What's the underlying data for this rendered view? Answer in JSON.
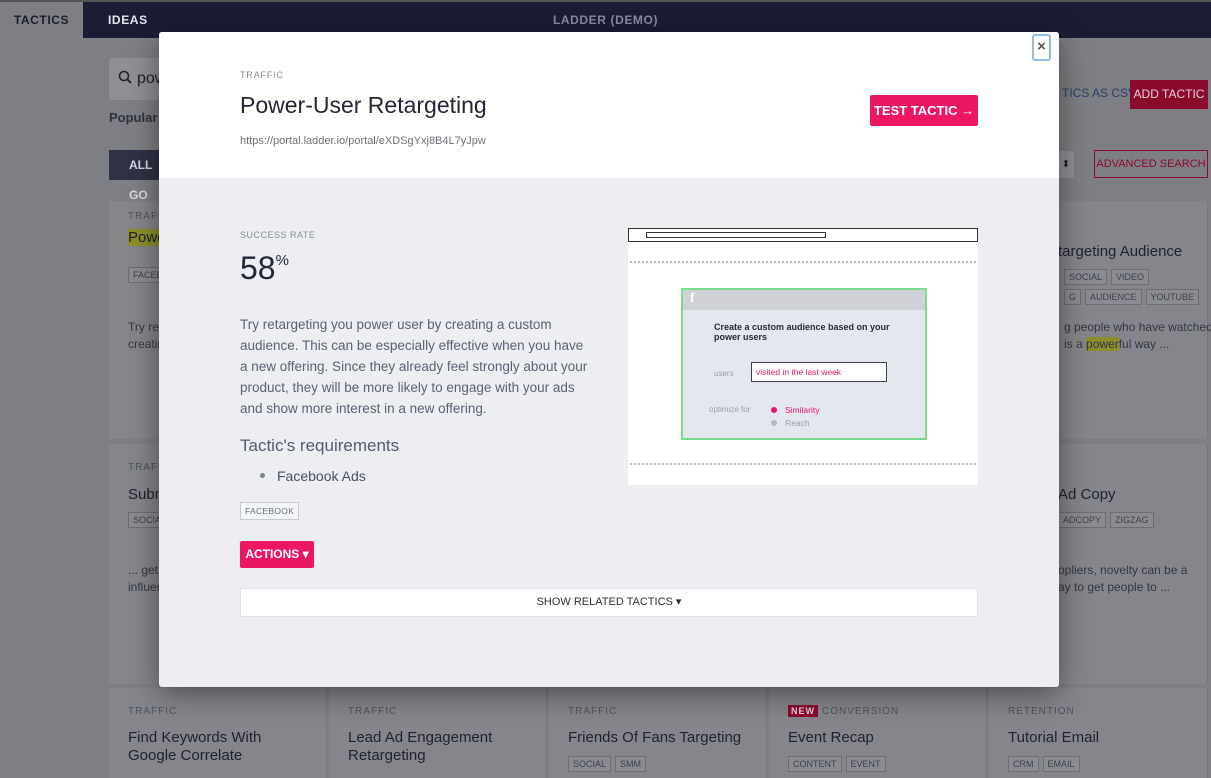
{
  "topnav": {
    "tabs": [
      "TACTICS",
      "IDEAS"
    ],
    "title": "LADDER (DEMO)"
  },
  "background": {
    "search_value": "pow",
    "popular_label": "Popular s",
    "all_goals_label": "ALL GO",
    "export_label": "TICS AS CSV",
    "add_tactic_label": "ADD TACTIC",
    "sort_glyph": "⬍",
    "advanced_search_label": "ADVANCED SEARCH",
    "cards_row1": [
      {
        "category": "TRAFFI",
        "title": "Powe",
        "tags": [
          "FACEBO"
        ],
        "excerpt": "Try ret\ncreatin"
      },
      {
        "category": "",
        "title": "targeting Audience",
        "tags": [
          "SOCIAL",
          "VIDEO"
        ],
        "tags2": [
          "G",
          "AUDIENCE",
          "YOUTUBE"
        ],
        "excerpt_pre": "g people who have watched\nis a ",
        "excerpt_hl": "power",
        "excerpt_post": "ful way ..."
      }
    ],
    "cards_row2": [
      {
        "category": "TRAFFI",
        "title": "Subm",
        "tags": [
          "SOCIAL"
        ],
        "excerpt": "... get i\ninfluen"
      },
      {
        "category": "",
        "title": "Ad Copy",
        "tags": [
          "ADCOPY",
          "ZIGZAG"
        ],
        "excerpt": "opliers, novelty can be a\nay to get people to ..."
      }
    ],
    "cards_row3": [
      {
        "category": "TRAFFIC",
        "title": "Find Keywords With Google Correlate",
        "new": "",
        "tags": []
      },
      {
        "category": "TRAFFIC",
        "title": "Lead Ad Engagement Retargeting",
        "new": "",
        "tags": []
      },
      {
        "category": "TRAFFIC",
        "title": "Friends Of Fans Targeting",
        "new": "",
        "tags": [
          "SOCIAL",
          "SMM"
        ]
      },
      {
        "category": "CONVERSION",
        "title": "Event Recap",
        "new": "NEW",
        "tags": [
          "CONTENT",
          "EVENT"
        ]
      },
      {
        "category": "RETENTION",
        "title": "Tutorial Email",
        "new": "",
        "tags": [
          "CRM",
          "EMAIL"
        ]
      }
    ]
  },
  "modal": {
    "category": "TRAFFIC",
    "title": "Power-User Retargeting",
    "url": "https://portal.ladder.io/portal/eXDSgYxj8B4L7yJpw/ta",
    "test_button": "TEST TACTIC →",
    "close_glyph": "×",
    "success_rate_label": "SUCCESS RATE",
    "success_rate_value": "58",
    "success_rate_unit": "%",
    "description": "Try retargeting you power user by creating a custom audience. This can be especially effective when you have a new offering. Since they already feel strongly about your product, they will be more likely to engage with your ads and show more interest in a new offering.",
    "requirements_title": "Tactic's requirements",
    "requirements": [
      "Facebook Ads"
    ],
    "tag": "FACEBOOK",
    "actions_button": "ACTIONS ▾",
    "related_button": "SHOW RELATED TACTICS ▾",
    "illustration": {
      "fb_glyph": "f",
      "heading": "Create a custom audience based on your power users",
      "users_label": "users",
      "users_value": "visited in the last week",
      "optimize_label": "optimize for",
      "option_selected": "Similarity",
      "option_other": "Reach"
    }
  }
}
